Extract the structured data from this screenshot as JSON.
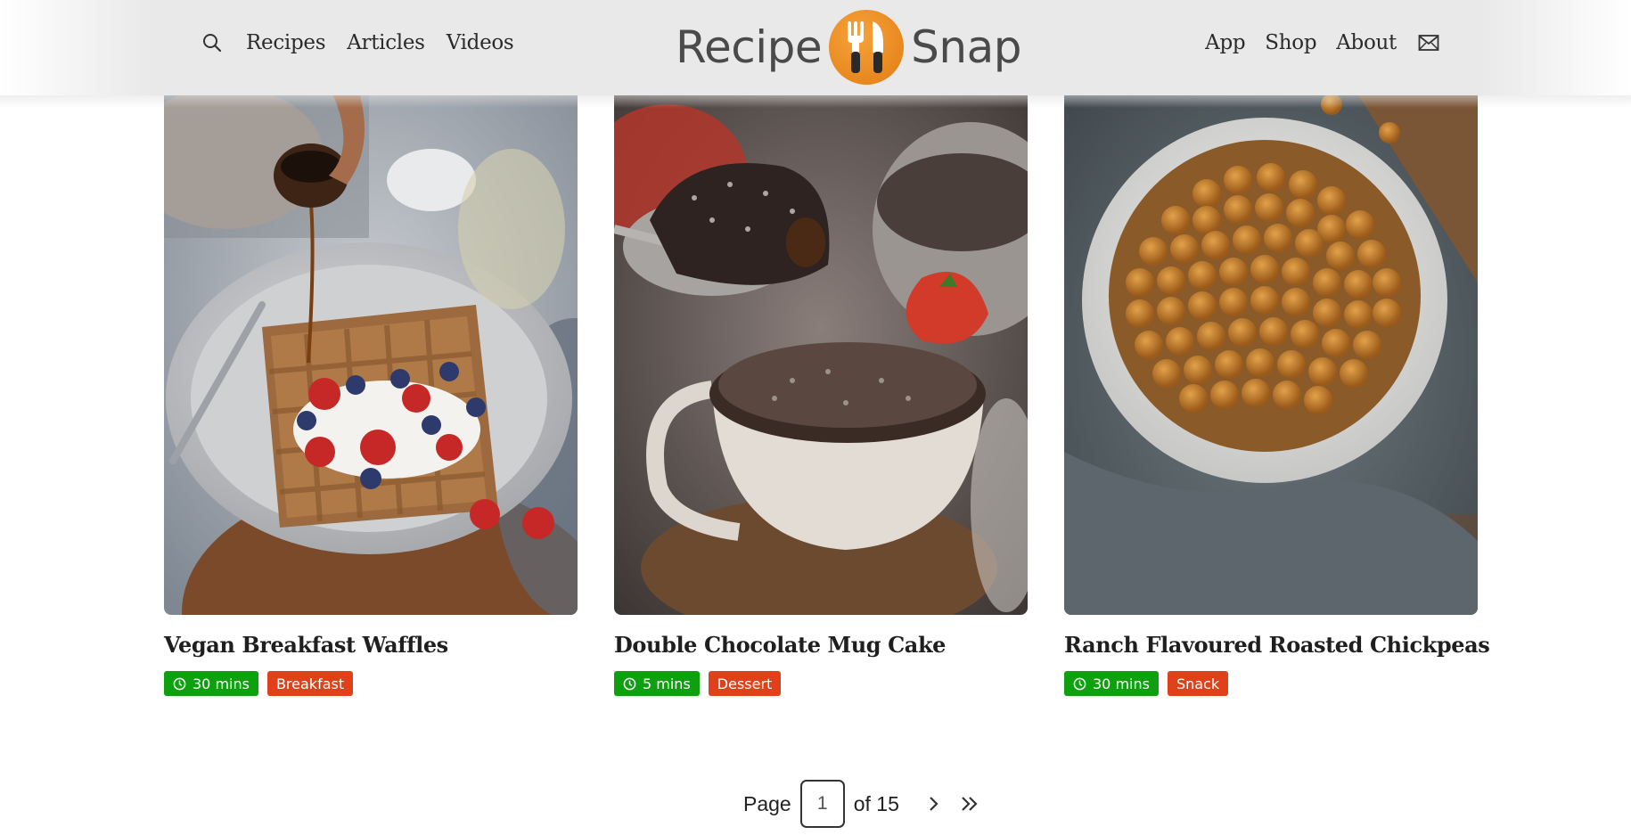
{
  "header": {
    "nav_left": [
      "Recipes",
      "Articles",
      "Videos"
    ],
    "nav_right": [
      "App",
      "Shop",
      "About"
    ],
    "logo": {
      "left": "Recipe",
      "right": "Snap"
    },
    "icons": {
      "search": "search-icon",
      "mail": "mail-icon",
      "logo": "fork-knife-icon"
    }
  },
  "cards": [
    {
      "title": "Vegan Breakfast Waffles",
      "time": "30 mins",
      "category": "Breakfast"
    },
    {
      "title": "Double Chocolate Mug Cake",
      "time": "5 mins",
      "category": "Dessert"
    },
    {
      "title": "Ranch Flavoured Roasted Chickpeas",
      "time": "30 mins",
      "category": "Snack"
    }
  ],
  "pagination": {
    "label": "Page",
    "current": "1",
    "total_text": "of 15"
  },
  "colors": {
    "time_tag": "#0ea00e",
    "category_tag": "#e0401a",
    "logo_badge": "#f0941f"
  }
}
